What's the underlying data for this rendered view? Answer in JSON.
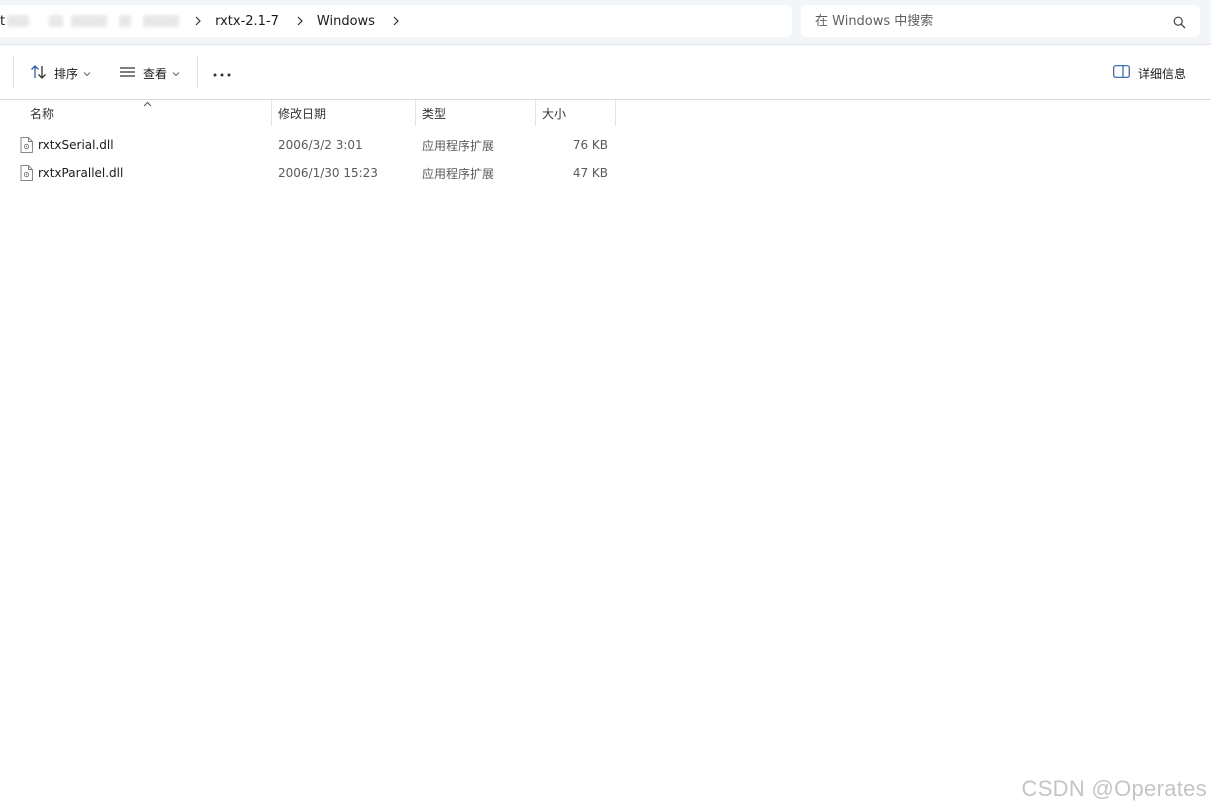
{
  "address_bar": {
    "crumbs_visible": [
      "rxtx-2.1-7",
      "Windows"
    ],
    "partial_leading_text": "t"
  },
  "search": {
    "placeholder": "在 Windows 中搜索"
  },
  "toolbar": {
    "sort_label": "排序",
    "view_label": "查看",
    "more_label": "···",
    "details_label": "详细信息"
  },
  "columns": {
    "name": "名称",
    "modified": "修改日期",
    "type": "类型",
    "size": "大小"
  },
  "files": [
    {
      "name": "rxtxSerial.dll",
      "modified": "2006/3/2 3:01",
      "type": "应用程序扩展",
      "size": "76 KB"
    },
    {
      "name": "rxtxParallel.dll",
      "modified": "2006/1/30 15:23",
      "type": "应用程序扩展",
      "size": "47 KB"
    }
  ],
  "watermark": "CSDN @Operates",
  "icons": [
    "chevron-right-icon",
    "search-icon",
    "sort-icon",
    "view-icon",
    "chevron-down-icon",
    "more-icon",
    "details-pane-icon",
    "sort-up-icon",
    "dll-file-icon"
  ],
  "colors": {
    "topbar_bg": "#f3f6f9",
    "watermark": "#c4c4c4"
  }
}
